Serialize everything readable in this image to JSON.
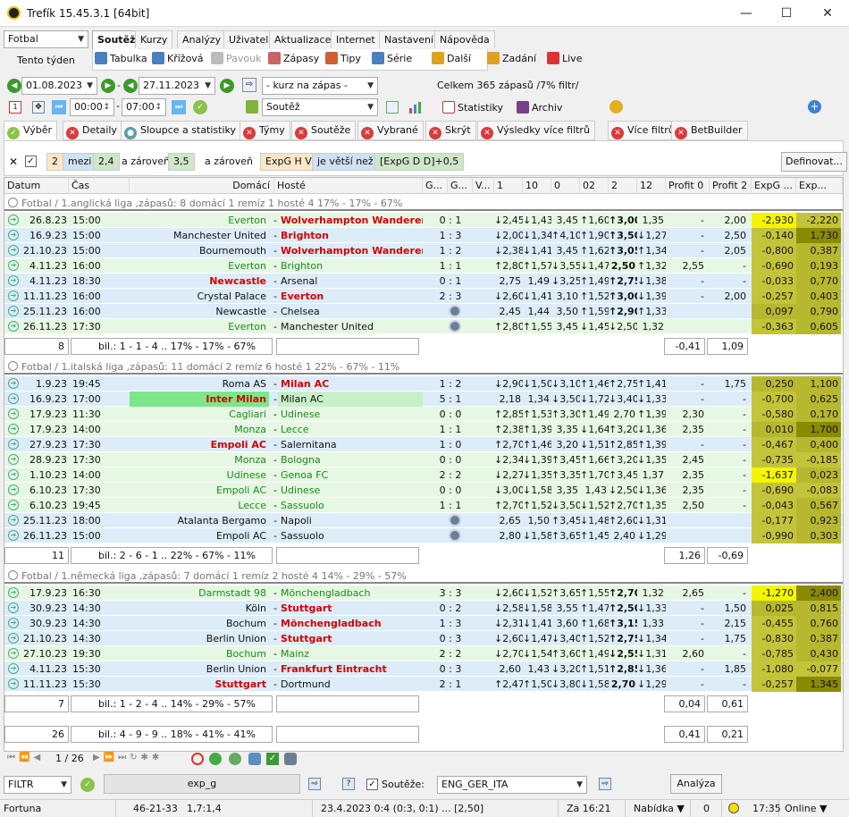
{
  "window": {
    "title": "Trefík 15.45.3.1 [64bit]"
  },
  "sport_select": "Fotbal",
  "period_label": "Tento týden",
  "main_tabs": [
    "Soutěž",
    "Kurzy",
    "Analýzy",
    "Uživatel",
    "Aktualizace",
    "Internet",
    "Nastavení",
    "Nápověda"
  ],
  "toolbar": [
    "Tabulka",
    "Křížová",
    "Pavouk",
    "Zápasy",
    "Tipy",
    "Série",
    "Další",
    "Zadání",
    "Live"
  ],
  "date_from": "01.08.2023",
  "date_to": "27.11.2023",
  "time_from": "00:00",
  "time_to": "07:00",
  "odds_select": "- kurz na zápas -",
  "competition_select": "Soutěž",
  "summary_text": "Celkem 365 zápasů /7% filtr/",
  "stats_label": "Statistiky",
  "archive_label": "Archiv",
  "filter_tabs": [
    "Výběr",
    "Detaily",
    "Sloupce a statistiky",
    "Týmy",
    "Soutěže",
    "Vybrané",
    "Skrýt",
    "Výsledky více filtrů",
    "Více filtrů",
    "BetBuilder"
  ],
  "filter_chips": {
    "a": "2",
    "b": "mezi",
    "c": "2,4",
    "d": "a zároveň",
    "e": "3,5",
    "f": "a zároveň",
    "g": "ExpG H V",
    "h": "je větší než",
    "i": "[ExpG D D]+0,5"
  },
  "define_button": "Definovat...",
  "columns": [
    "Datum",
    "Čas",
    "Domácí",
    "Hosté",
    "G...",
    "G...",
    "V...",
    "1",
    "10",
    "0",
    "02",
    "2",
    "12",
    "Profit 0",
    "Profit 2",
    "ExpG ...",
    "Exp..."
  ],
  "groups": [
    {
      "title": "Fotbal / 1.anglická liga ,zápasů: 8  domácí 1  remíz 1  hosté 4       17% - 17% - 67%",
      "count": "8",
      "summary": "bil.: 1 - 1 - 4 .. 17% - 17% - 67%",
      "profit0": "-0,41",
      "profit2": "1,09",
      "rows": [
        [
          "26.8.23",
          "15:00",
          "Everton",
          "Wolverhampton Wanderers",
          "0 : 1",
          "↓2,45",
          "↓1,43",
          "3,45",
          "↑1,60",
          "↑3,00",
          "1,35",
          "-",
          "2,00",
          "-2,930",
          "-2,220"
        ],
        [
          "16.9.23",
          "15:00",
          "Manchester United",
          "Brighton",
          "1 : 3",
          "↓2,00",
          "↓1,34",
          "↑4,10",
          "↑1,90",
          "↑3,50",
          "↓1,27",
          "-",
          "2,50",
          "-0,140",
          "1,730"
        ],
        [
          "21.10.23",
          "15:00",
          "Bournemouth",
          "Wolverhampton Wanderers",
          "1 : 2",
          "↓2,38",
          "↓1,41",
          "3,45",
          "↑1,62",
          "↑3,05",
          "↑1,34",
          "-",
          "2,05",
          "-0,800",
          "0,387"
        ],
        [
          "4.11.23",
          "16:00",
          "Everton",
          "Brighton",
          "1 : 1",
          "↑2,80",
          "↑1,57",
          "↓3,55",
          "↓1,47",
          "2,50",
          "↑1,32",
          "2,55",
          "-",
          "-0,690",
          "0,193"
        ],
        [
          "4.11.23",
          "18:30",
          "Newcastle",
          "Arsenal",
          "0 : 1",
          "2,75",
          "1,49",
          "↓3,25",
          "↑1,49",
          "↑2,75",
          "↓1,38",
          "-",
          "-",
          "-0,033",
          "0,770"
        ],
        [
          "11.11.23",
          "16:00",
          "Crystal Palace",
          "Everton",
          "2 : 3",
          "↓2,60",
          "↓1,41",
          "3,10",
          "↑1,52",
          "↑3,00",
          "↓1,39",
          "-",
          "2,00",
          "-0,257",
          "0,403"
        ],
        [
          "25.11.23",
          "16:00",
          "Newcastle",
          "Chelsea",
          "",
          "2,45",
          "1,44",
          "3,50",
          "↑1,59",
          "↑2,90",
          "↑1,33",
          "",
          "",
          "0,097",
          "0,790"
        ],
        [
          "26.11.23",
          "17:30",
          "Everton",
          "Manchester United",
          "",
          "↑2,80",
          "↑1,55",
          "3,45",
          "↓1,45",
          "↓2,50",
          "1,32",
          "",
          "",
          "-0,363",
          "0,605"
        ]
      ],
      "hstyle": [
        "g",
        "n",
        "n",
        "g",
        "r",
        "n",
        "n",
        "g"
      ],
      "gstyle": [
        "r",
        "r",
        "r",
        "g",
        "n",
        "r",
        "n",
        "n"
      ]
    },
    {
      "title": "Fotbal / 1.italská liga ,zápasů: 11  domácí 2  remíz 6  hosté 1       22% - 67% - 11%",
      "count": "11",
      "summary": "bil.: 2 - 6 - 1 .. 22% - 67% - 11%",
      "profit0": "1,26",
      "profit2": "-0,69",
      "rows": [
        [
          "1.9.23",
          "19:45",
          "Roma AS",
          "Milan AC",
          "1 : 2",
          "↓2,90",
          "↓1,50",
          "↓3,10",
          "↑1,46",
          "↑2,75",
          "↑1,41",
          "-",
          "1,75",
          "0,250",
          "1,100"
        ],
        [
          "16.9.23",
          "17:00",
          "Inter Milan",
          "Milan AC",
          "5 : 1",
          "2,18",
          "1,34",
          "↓3,50",
          "↓1,72",
          "↓3,40",
          "↓1,33",
          "-",
          "-",
          "-0,700",
          "0,625"
        ],
        [
          "17.9.23",
          "11:30",
          "Cagliari",
          "Udinese",
          "0 : 0",
          "↑2,85",
          "↑1,53",
          "↑3,30",
          "↑1,49",
          "2,70",
          "↑1,39",
          "2,30",
          "-",
          "-0,580",
          "0,170"
        ],
        [
          "17.9.23",
          "14:00",
          "Monza",
          "Lecce",
          "1 : 1",
          "↑2,38",
          "↑1,39",
          "3,35",
          "↓1,64",
          "↑3,20",
          "↓1,36",
          "2,35",
          "-",
          "0,010",
          "1,700"
        ],
        [
          "27.9.23",
          "17:30",
          "Empoli AC",
          "Salernitana",
          "1 : 0",
          "↑2,70",
          "↑1,46",
          "3,20",
          "↓1,51",
          "↑2,85",
          "↑1,39",
          "-",
          "-",
          "-0,467",
          "0,400"
        ],
        [
          "28.9.23",
          "17:30",
          "Monza",
          "Bologna",
          "0 : 0",
          "↓2,34",
          "↓1,39",
          "↑3,45",
          "↑1,66",
          "↑3,20",
          "↓1,35",
          "2,45",
          "-",
          "-0,735",
          "-0,185"
        ],
        [
          "1.10.23",
          "14:00",
          "Udinese",
          "Genoa FC",
          "2 : 2",
          "↓2,27",
          "↓1,35",
          "↑3,35",
          "↑1,70",
          "↑3,45",
          "1,37",
          "2,35",
          "-",
          "-1,637",
          "0,023"
        ],
        [
          "6.10.23",
          "17:30",
          "Empoli AC",
          "Udinese",
          "0 : 0",
          "↓3,00",
          "↓1,58",
          "3,35",
          "1,43",
          "↓2,50",
          "↓1,36",
          "2,35",
          "-",
          "-0,690",
          "-0,083"
        ],
        [
          "6.10.23",
          "19:45",
          "Lecce",
          "Sassuolo",
          "1 : 1",
          "↑2,70",
          "↑1,52",
          "↓3,50",
          "↓1,52",
          "↑2,70",
          "↑1,35",
          "2,50",
          "-",
          "-0,043",
          "0,567"
        ],
        [
          "25.11.23",
          "18:00",
          "Atalanta Bergamo",
          "Napoli",
          "",
          "2,65",
          "1,50",
          "↑3,45",
          "↓1,48",
          "↑2,60",
          "↓1,31",
          "",
          "",
          "-0,177",
          "0,923"
        ],
        [
          "26.11.23",
          "15:00",
          "Empoli AC",
          "Sassuolo",
          "",
          "2,80",
          "↓1,58",
          "↑3,65",
          "↑1,45",
          "2,40",
          "↓1,29",
          "",
          "",
          "-0,990",
          "0,303"
        ]
      ],
      "hstyle": [
        "n",
        "r",
        "g",
        "g",
        "r",
        "g",
        "g",
        "g",
        "g",
        "n",
        "n"
      ],
      "gstyle": [
        "r",
        "n",
        "g",
        "g",
        "n",
        "g",
        "g",
        "g",
        "g",
        "n",
        "n"
      ]
    },
    {
      "title": "Fotbal / 1.německá liga ,zápasů: 7  domácí 1  remíz 2  hosté 4       14% - 29% - 57%",
      "count": "7",
      "summary": "bil.: 1 - 2 - 4 .. 14% - 29% - 57%",
      "profit0": "0,04",
      "profit2": "0,61",
      "rows": [
        [
          "17.9.23",
          "16:30",
          "Darmstadt 98",
          "Mönchengladbach",
          "3 : 3",
          "↓2,60",
          "↓1,52",
          "↑3,65",
          "↑1,55",
          "↑2,70",
          "1,32",
          "2,65",
          "-",
          "-1,270",
          "2,400"
        ],
        [
          "30.9.23",
          "14:30",
          "Köln",
          "Stuttgart",
          "0 : 2",
          "↓2,58",
          "↓1,58",
          "3,55",
          "↑1,47",
          "↑2,50",
          "↓1,33",
          "-",
          "1,50",
          "0,025",
          "0,815"
        ],
        [
          "30.9.23",
          "14:30",
          "Bochum",
          "Mönchengladbach",
          "1 : 3",
          "↓2,31",
          "↓1,41",
          "3,60",
          "↑1,68",
          "↑3,15",
          "1,33",
          "-",
          "2,15",
          "-0,455",
          "0,760"
        ],
        [
          "21.10.23",
          "14:30",
          "Berlin Union",
          "Stuttgart",
          "0 : 3",
          "↓2,60",
          "↓1,47",
          "↓3,40",
          "↑1,52",
          "↑2,75",
          "↓1,34",
          "-",
          "1,75",
          "-0,830",
          "0,387"
        ],
        [
          "27.10.23",
          "19:30",
          "Bochum",
          "Mainz",
          "2 : 2",
          "↓2,70",
          "↓1,54",
          "↑3,60",
          "↑1,49",
          "↓2,55",
          "↓1,31",
          "2,60",
          "-",
          "-0,785",
          "0,430"
        ],
        [
          "4.11.23",
          "15:30",
          "Berlin Union",
          "Frankfurt Eintracht",
          "0 : 3",
          "2,60",
          "1,43",
          "↓3,20",
          "↑1,51",
          "↑2,85",
          "↓1,36",
          "-",
          "1,85",
          "-1,080",
          "-0,077"
        ],
        [
          "11.11.23",
          "15:30",
          "Stuttgart",
          "Dortmund",
          "2 : 1",
          "↑2,47",
          "↑1,50",
          "↓3,80",
          "↓1,58",
          "2,70",
          "↓1,29",
          "-",
          "-",
          "-0,257",
          "1,345"
        ]
      ],
      "hstyle": [
        "g",
        "n",
        "n",
        "n",
        "g",
        "n",
        "r"
      ],
      "gstyle": [
        "g",
        "r",
        "r",
        "r",
        "g",
        "r",
        "n"
      ]
    }
  ],
  "total": {
    "count": "26",
    "summary": "bil.: 4 - 9 - 9 .. 18% - 41% - 41%",
    "profit0": "0,41",
    "profit2": "0,21"
  },
  "pager": "1 / 26",
  "bottom": {
    "filter_select": "FILTR",
    "filter_name": "exp_g",
    "competitions_label": "Soutěže:",
    "competitions_value": "ENG_GER_ITA",
    "analyze_button": "Analýza"
  },
  "status": {
    "site": "Fortuna",
    "stat1": "46-21-33",
    "stat2": "1,7:1,4",
    "match": "23.4.2023 0:4 (0:3, 0:1) ... [2,50]",
    "za": "Za 16:21",
    "offer": "Nabídka",
    "count": "0",
    "time": "17:35",
    "online": "Online"
  }
}
